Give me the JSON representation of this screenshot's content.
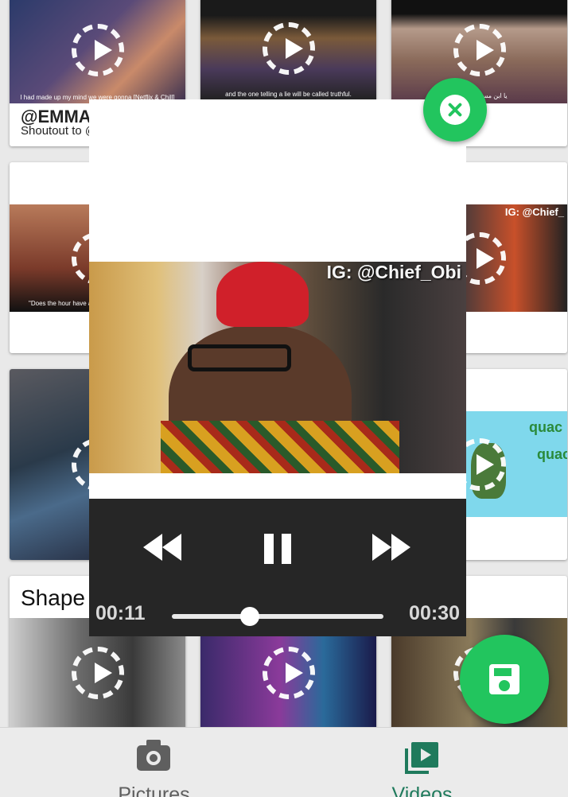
{
  "grid": {
    "cards": [
      {
        "overlay_top": "@EMMA",
        "overlay_bottom": "Shoutout to @",
        "caption": "I had made up my mind we were gonna [Netflix & Chill]"
      },
      {
        "caption": "and the one telling a lie will be called truthful."
      },
      {
        "caption": "يا ابن مسعود ، إن من"
      },
      {
        "caption": "\"Does the hour have a s"
      },
      {
        "overlay": "IG: @Chief_"
      },
      {
        "title": "Shape"
      },
      {
        "overlay": "quac"
      },
      {
        "overlay": "quac"
      }
    ]
  },
  "player": {
    "video_overlay_text": "IG: @Chief_Obi",
    "current_time": "00:11",
    "total_time": "00:30",
    "progress": 0.37
  },
  "bottom_nav": {
    "pictures_label": "Pictures",
    "videos_label": "Videos"
  },
  "colors": {
    "accent": "#22c55e",
    "nav_active": "#1f7a5c",
    "nav_inactive": "#5f5f5f",
    "player_bar": "#262626"
  }
}
